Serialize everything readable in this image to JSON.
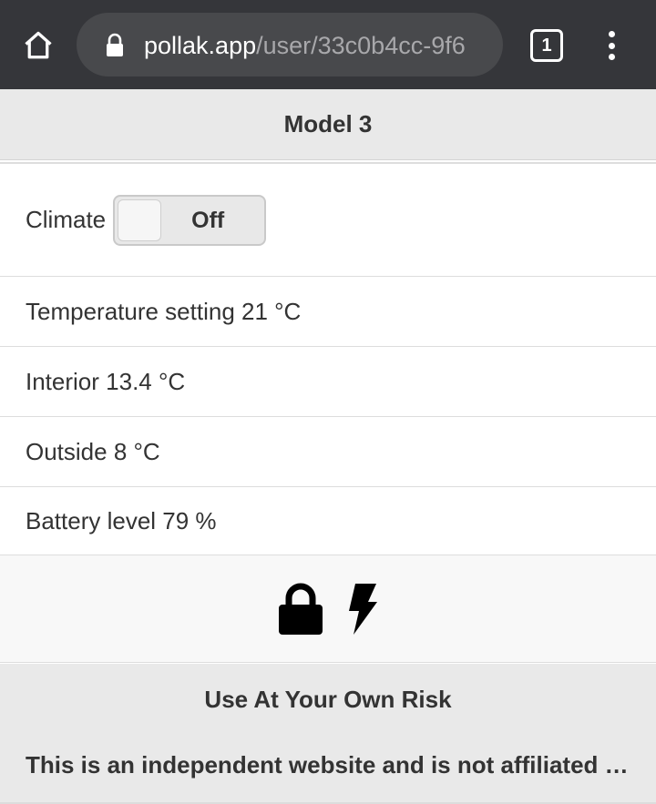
{
  "browser": {
    "url_host": "pollak.app",
    "url_path": "/user/33c0b4cc-9f6",
    "tab_count": "1"
  },
  "header": {
    "title": "Model 3"
  },
  "climate": {
    "label": "Climate",
    "toggle_state": "Off"
  },
  "stats": [
    "Temperature setting 21 °C",
    "Interior 13.4 °C",
    "Outside 8 °C",
    "Battery level 79 %"
  ],
  "status_icons": [
    "lock-icon",
    "bolt-icon"
  ],
  "footer": {
    "title": "Use At Your Own Risk",
    "text": "This is an independent website and is not affiliated with Tesla, Inc."
  },
  "colors": {
    "browser_bar": "#35363a",
    "header_bg": "#e9e9e9",
    "text": "#333333"
  }
}
